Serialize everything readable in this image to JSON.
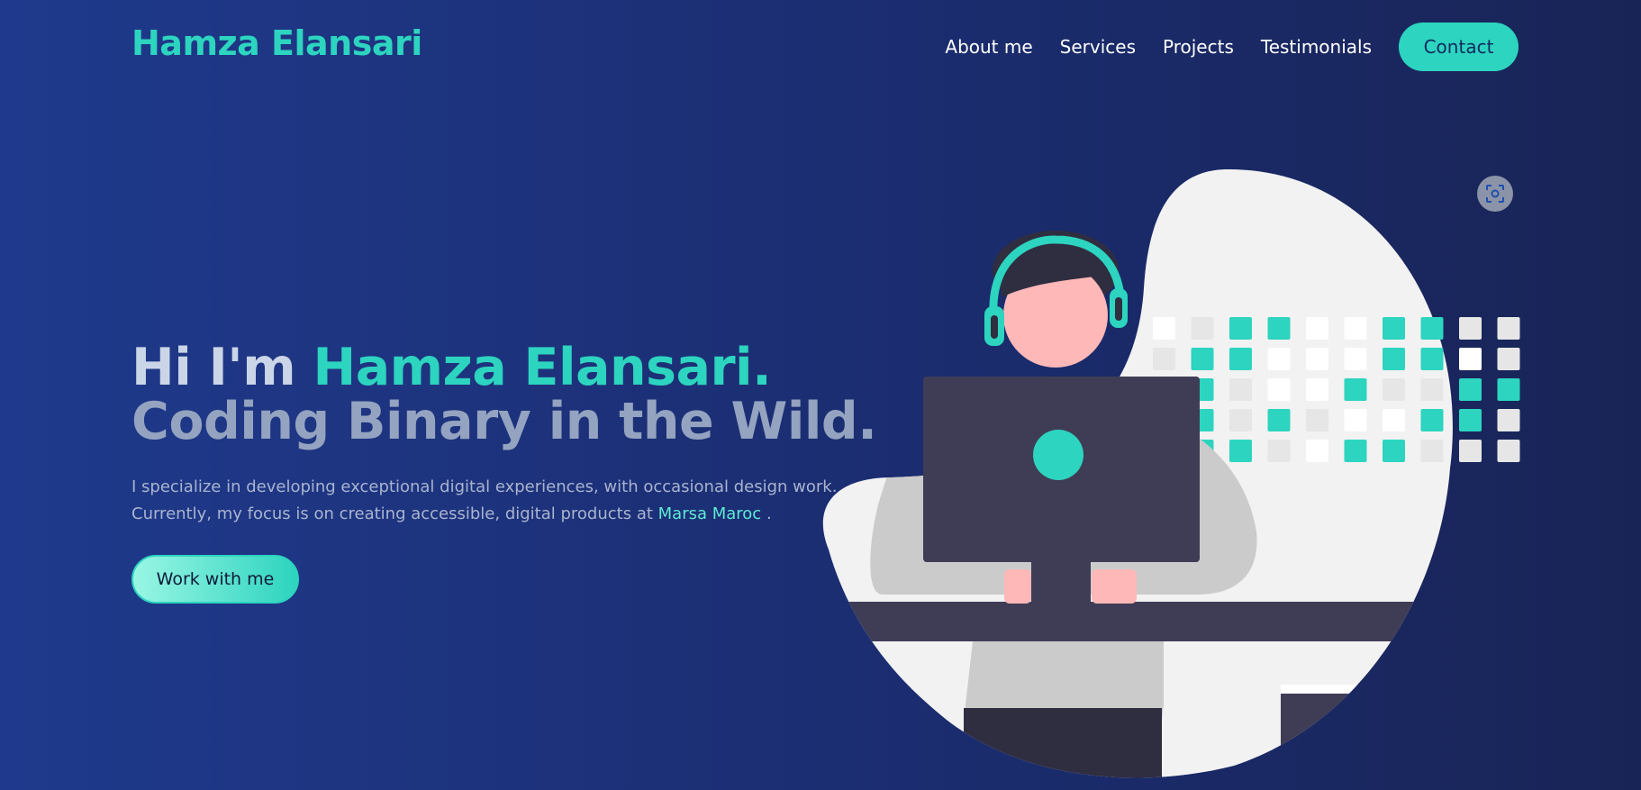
{
  "brand": {
    "name": "Hamza Elansari"
  },
  "nav": {
    "items": [
      "About me",
      "Services",
      "Projects",
      "Testimonials"
    ],
    "contact_label": "Contact"
  },
  "hero": {
    "greeting": "Hi I'm ",
    "name": "Hamza Elansari.",
    "tagline": "Coding Binary in the Wild.",
    "description_line1": "I specialize in developing exceptional digital experiences, with occasional design work.",
    "description_line2": "Currently, my focus is on creating accessible, digital products at ",
    "company": "Marsa Maroc",
    "description_end": " .",
    "cta_label": "Work with me"
  },
  "icons": {
    "scan": "scan-icon"
  },
  "colors": {
    "accent": "#2dd4bf",
    "bg_dark": "#1c2f75",
    "screen": "#3f3d56"
  }
}
